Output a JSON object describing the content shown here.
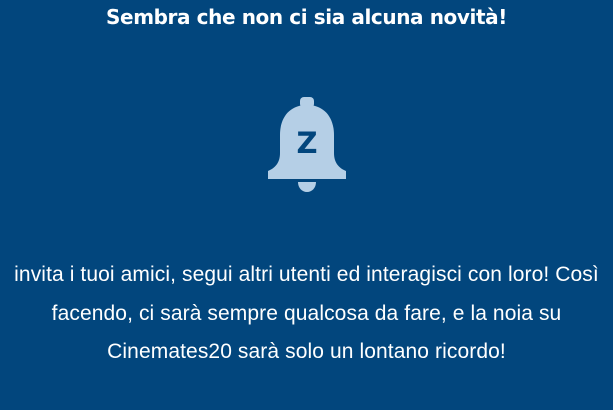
{
  "empty_state": {
    "title": "Sembra che non ci sia alcuna novità!",
    "icon": "bell-z-icon",
    "icon_letter": "Z",
    "message": "invita i tuoi amici, segui altri utenti ed interagisci con loro! Così facendo, ci sarà sempre qualcosa da fare, e la noia su Cinemates20 sarà solo un lontano ricordo!"
  },
  "colors": {
    "background": "#02467d",
    "text": "#ffffff",
    "icon": "#b5cfe6"
  }
}
